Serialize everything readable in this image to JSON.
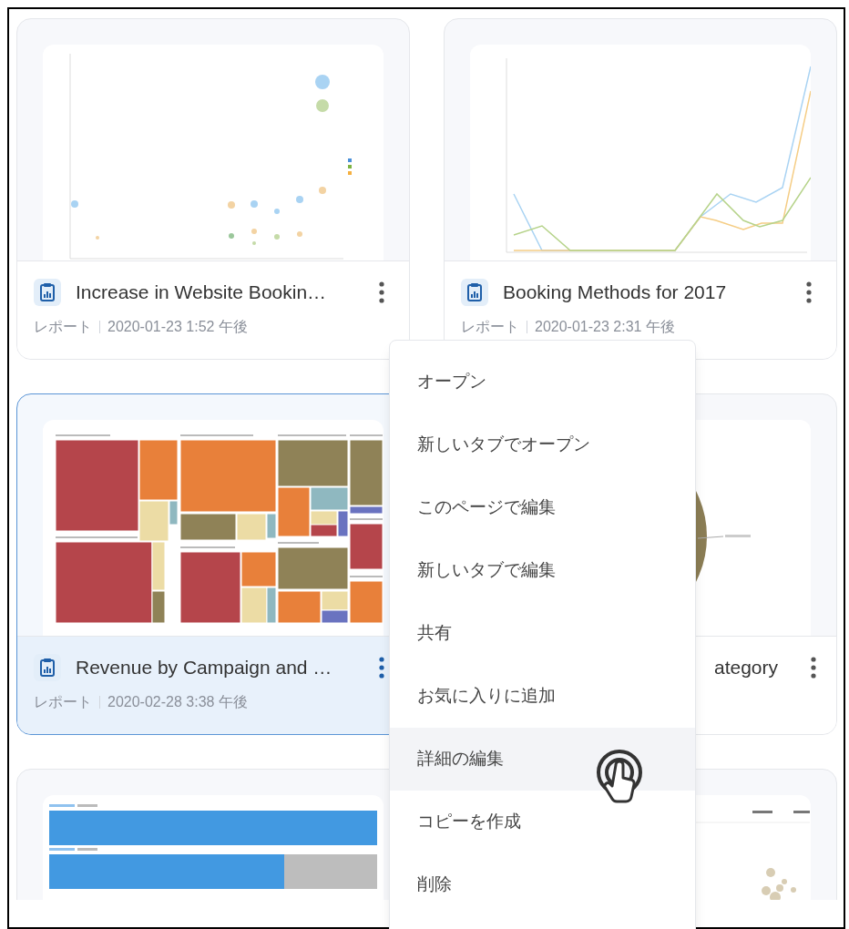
{
  "cards": [
    {
      "kind": "scatter",
      "selected": false,
      "title": "Increase in Website Bookin…",
      "type": "レポート",
      "date": "2020-01-23 1:52 午後"
    },
    {
      "kind": "line",
      "selected": false,
      "title": "Booking Methods for 2017",
      "type": "レポート",
      "date": "2020-01-23 2:31 午後"
    },
    {
      "kind": "treemap",
      "selected": true,
      "title": "Revenue by Campaign and …",
      "type": "レポート",
      "date": "2020-02-28 3:38 午後"
    },
    {
      "kind": "pie",
      "selected": false,
      "title": "ategory"
    },
    {
      "kind": "bar",
      "selected": false
    },
    {
      "kind": "bubble",
      "selected": false
    }
  ],
  "menu": {
    "items": [
      {
        "label": "オープン",
        "hovered": false
      },
      {
        "label": "新しいタブでオープン",
        "hovered": false
      },
      {
        "label": "このページで編集",
        "hovered": false
      },
      {
        "label": "新しいタブで編集",
        "hovered": false
      },
      {
        "label": "共有",
        "hovered": false
      },
      {
        "label": "お気に入りに追加",
        "hovered": false
      },
      {
        "label": "詳細の編集",
        "hovered": true
      },
      {
        "label": "コピーを作成",
        "hovered": false
      },
      {
        "label": "削除",
        "hovered": false
      }
    ]
  }
}
